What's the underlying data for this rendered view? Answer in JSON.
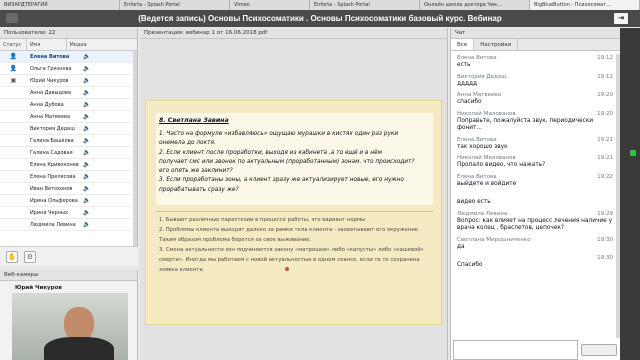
{
  "tabs": [
    "ВИЗАРДТЕРАГИЯ",
    "Enforta - Splash Portal",
    "Vimeo",
    "Enforta - Splash Portal",
    "Онлайн школа доктора Чик…",
    "BigBlueButton - Психосомат…"
  ],
  "title": "(Ведется запись) Основы Психосоматики . Основы Психосоматики базовый курс. Вебинар",
  "users": {
    "header": "Пользователи: 22",
    "columns": [
      "Статус",
      "Имя",
      "Медиа"
    ],
    "rows": [
      {
        "name": "Елена Витова",
        "status": "person-icon",
        "me": true
      },
      {
        "name": "Ольга Грязнова",
        "status": "person-icon",
        "me": false
      },
      {
        "name": "Юрий Чикуров",
        "status": "presenter-icon",
        "me": false
      },
      {
        "name": "Анна Давыдова",
        "status": "",
        "me": false
      },
      {
        "name": "Анна Дубова",
        "status": "",
        "me": false
      },
      {
        "name": "Анна Матвеева",
        "status": "",
        "me": false
      },
      {
        "name": "Виктория Дедеш",
        "status": "",
        "me": false
      },
      {
        "name": "Галина Башкова",
        "status": "",
        "me": false
      },
      {
        "name": "Галина Садовая",
        "status": "",
        "me": false
      },
      {
        "name": "Елена Кривоконева",
        "status": "",
        "me": false
      },
      {
        "name": "Елена Прелясова",
        "status": "",
        "me": false
      },
      {
        "name": "Иван Ветохонов",
        "status": "",
        "me": false
      },
      {
        "name": "Ирина Ольферова",
        "status": "",
        "me": false
      },
      {
        "name": "Ирина Черных",
        "status": "",
        "me": false
      },
      {
        "name": "Людмила Левина",
        "status": "",
        "me": false
      }
    ]
  },
  "webcams": {
    "header": "Веб-камеры",
    "name": "Юрий Чикуров"
  },
  "presentation": {
    "header": "Презентация: вебинар 1 от 16.06.2018.pdf",
    "slide_title": "8. Светлана Завина",
    "slide_question": "1. Часто на формуле «избавляюсь» ощущаю мурашки в кистях один раз руки\nонемела до локтя.\n2. Если клиент после проработки, выходя из кабинета ,а то ещё и в нём\nполучает смс или звонок по актуальным (проработанным) зонам. что происходит?\nего опять же заклинит?\n3. Если проработаны зоны, а клиент зразу же актуализирует новые, его нужно\nпрорабатывать сразу же?",
    "slide_answer": [
      "1. Бывают различные парестезии в процессе работы, это вариант нормы",
      "2. Проблемы клиента выходят далеко за рамки тела клиента - захватывают его окружение.",
      "Таким образом проблема борется за свое выживание.",
      "3. Смена актуальности зон подчиняется закону «матрешки» либо «капусты» либо «кашевой»",
      "смерти». Иногда мы работаем с новой актуальностью в одном сеансе, если та то сохранена",
      "зоявка клиента."
    ]
  },
  "chat": {
    "header": "Чат",
    "tabs": [
      "Все",
      "Настройки"
    ],
    "messages": [
      {
        "name": "Елена Витова",
        "time": "19:12",
        "text": "есть"
      },
      {
        "name": "Виктория Дедеш",
        "time": "19:12",
        "text": "ддддд"
      },
      {
        "name": "Анна Матвеева",
        "time": "19:20",
        "text": "спасибо"
      },
      {
        "name": "Николай Милованов",
        "time": "19:20",
        "text": "Поправьте, пожалуйста звук, периодически фонит..."
      },
      {
        "name": "Елена Витова",
        "time": "19:21",
        "text": "так хорошо звук"
      },
      {
        "name": "Николай Милованов",
        "time": "19:21",
        "text": "Пропало видео, что нажать?"
      },
      {
        "name": "Елена Витова",
        "time": "19:22",
        "text": "выйдете и войдите"
      },
      {
        "name": "",
        "time": "",
        "text": "видео есть"
      },
      {
        "name": "Людмила Левина",
        "time": "19:29",
        "text": "Вопрос: как влияет на процесс лечения наличие у врача колец , браслетов, цепочек?"
      },
      {
        "name": "Светлана Мирошниченко",
        "time": "19:30",
        "text": "да"
      },
      {
        "name": "",
        "time": "19:30",
        "text": "Спасибо"
      }
    ]
  }
}
